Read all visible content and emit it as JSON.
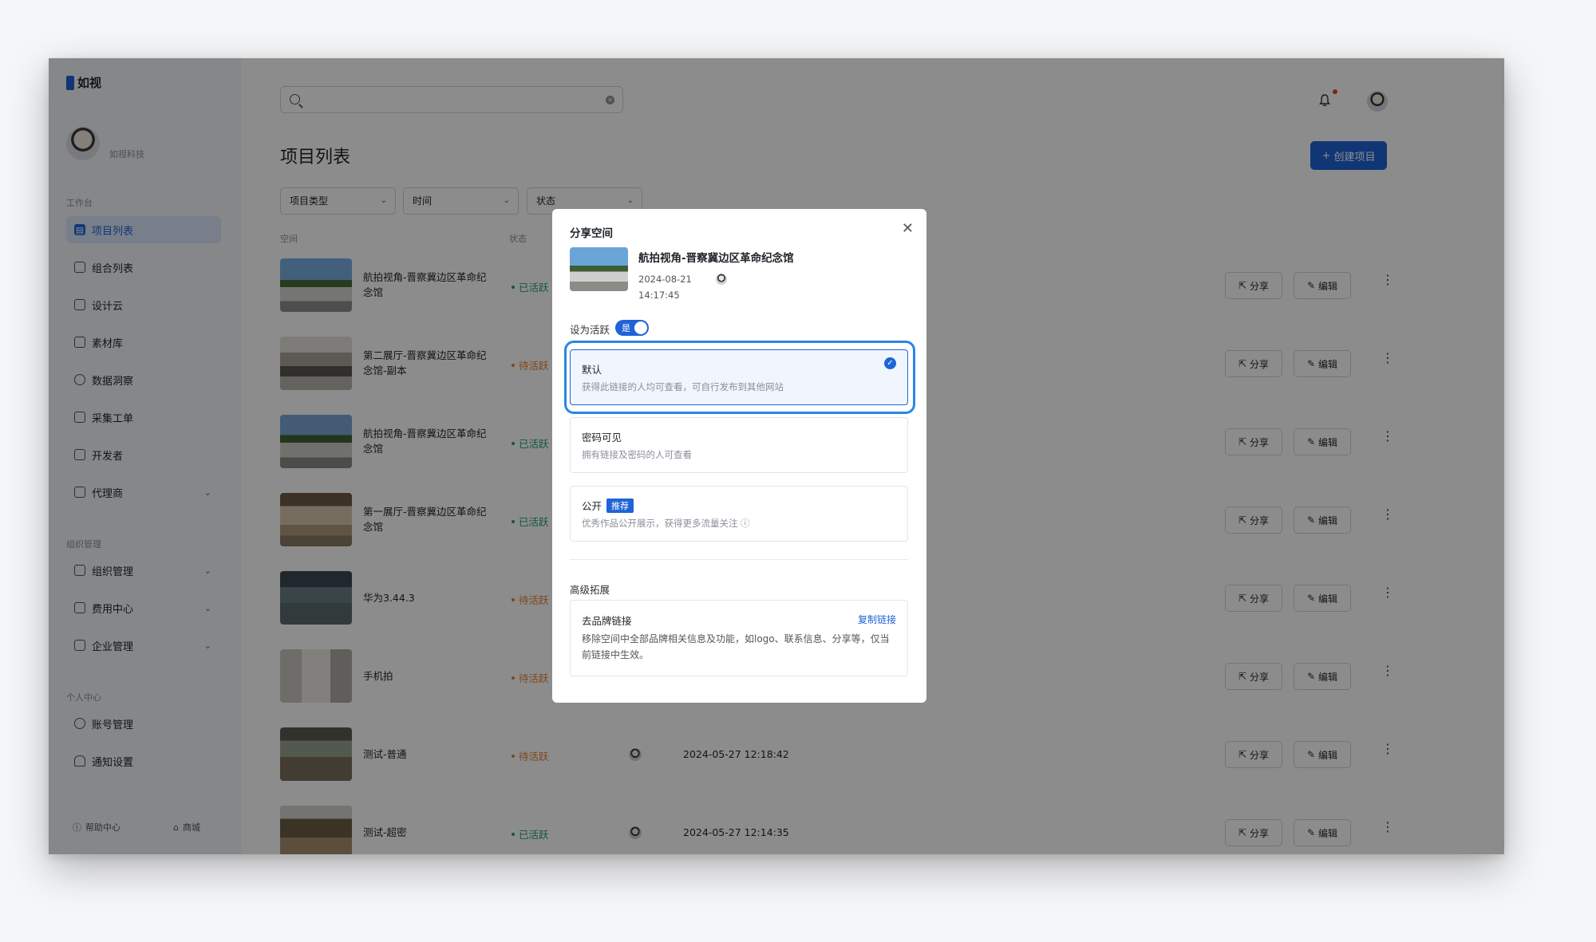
{
  "app": {
    "name": "如视"
  },
  "sidebar": {
    "org_name": "如视科技",
    "sections": [
      {
        "title": "工作台",
        "items": [
          {
            "label": "项目列表",
            "icon": "project-list-icon",
            "active": true
          },
          {
            "label": "组合列表",
            "icon": "layers-icon"
          },
          {
            "label": "设计云",
            "icon": "monitor-icon"
          },
          {
            "label": "素材库",
            "icon": "folder-icon"
          },
          {
            "label": "数据洞察",
            "icon": "pie-chart-icon"
          },
          {
            "label": "采集工单",
            "icon": "document-icon"
          },
          {
            "label": "开发者",
            "icon": "code-icon"
          },
          {
            "label": "代理商",
            "icon": "briefcase-icon",
            "expandable": true
          }
        ]
      },
      {
        "title": "组织管理",
        "items": [
          {
            "label": "组织管理",
            "icon": "org-icon",
            "expandable": true
          },
          {
            "label": "费用中心",
            "icon": "wallet-icon",
            "expandable": true
          },
          {
            "label": "企业管理",
            "icon": "shield-icon",
            "expandable": true
          }
        ]
      },
      {
        "title": "个人中心",
        "items": [
          {
            "label": "账号管理",
            "icon": "user-icon"
          },
          {
            "label": "通知设置",
            "icon": "bell-icon"
          }
        ]
      }
    ],
    "footer": {
      "help": "帮助中心",
      "store": "商城"
    }
  },
  "header": {
    "search_placeholder": "",
    "has_notification": true
  },
  "main": {
    "title": "项目列表",
    "create_label": "创建项目",
    "filters": [
      "项目类型",
      "时间",
      "状态"
    ],
    "columns": {
      "space": "空间",
      "status": "状态"
    },
    "actions": {
      "share": "分享",
      "edit": "编辑"
    },
    "rows": [
      {
        "name": "航拍视角-晋察冀边区革命纪念馆",
        "status": "已活跃",
        "status_type": "active",
        "time": ""
      },
      {
        "name": "第二展厅-晋察冀边区革命纪念馆-副本",
        "status": "待活跃",
        "status_type": "pending",
        "time": ""
      },
      {
        "name": "航拍视角-晋察冀边区革命纪念馆",
        "status": "已活跃",
        "status_type": "active",
        "time": ""
      },
      {
        "name": "第一展厅-晋察冀边区革命纪念馆",
        "status": "已活跃",
        "status_type": "active",
        "time": ""
      },
      {
        "name": "华为3.44.3",
        "status": "待活跃",
        "status_type": "pending",
        "time": ""
      },
      {
        "name": "手机拍",
        "status": "待活跃",
        "status_type": "pending",
        "time": ""
      },
      {
        "name": "测试-普通",
        "status": "待活跃",
        "status_type": "pending",
        "time": "2024-05-27 12:18:42"
      },
      {
        "name": "测试-超密",
        "status": "已活跃",
        "status_type": "active",
        "time": "2024-05-27 12:14:35"
      }
    ]
  },
  "modal": {
    "title": "分享空间",
    "project_name": "航拍视角-晋察冀边区革命纪念馆",
    "date": "2024-08-21",
    "time": "14:17:45",
    "active_label": "设为活跃",
    "toggle_label": "是",
    "options": [
      {
        "title": "默认",
        "desc": "获得此链接的人均可查看，可自行发布到其他网站",
        "selected": true,
        "tag": ""
      },
      {
        "title": "密码可见",
        "desc": "拥有链接及密码的人可查看",
        "selected": false,
        "tag": ""
      },
      {
        "title": "公开",
        "desc": "优秀作品公开展示，获得更多流量关注",
        "selected": false,
        "tag": "推荐"
      }
    ],
    "advanced": {
      "title": "高级拓展",
      "item_name": "去品牌链接",
      "item_link": "复制链接",
      "item_desc": "移除空间中全部品牌相关信息及功能，如logo、联系信息、分享等，仅当前链接中生效。"
    }
  },
  "colors": {
    "accent": "#1f63d8",
    "active_status": "#22a06b",
    "pending_status": "#e8812e",
    "focus_ring": "#2a86e6"
  }
}
